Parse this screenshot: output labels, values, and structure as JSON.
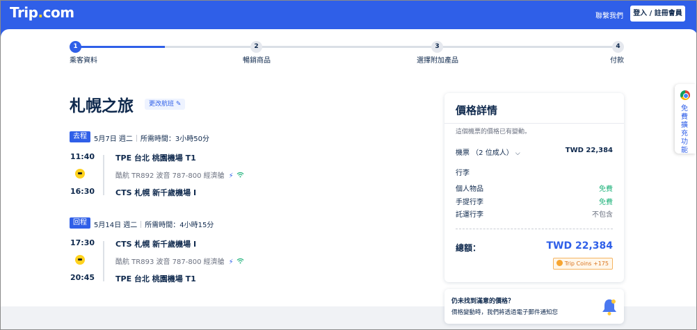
{
  "header": {
    "logo_main": "Trip",
    "logo_dot": ".",
    "logo_tail": "com",
    "contact_label": "聯繫我們",
    "login_label": "登入 / 註冊會員"
  },
  "stepper": {
    "steps": [
      {
        "num": "1",
        "label": "乘客資料"
      },
      {
        "num": "2",
        "label": "暢銷商品"
      },
      {
        "num": "3",
        "label": "選擇附加產品"
      },
      {
        "num": "4",
        "label": "付款"
      }
    ],
    "current_step": 1
  },
  "trip": {
    "title": "札幌之旅",
    "change_flight_label": "更改航班"
  },
  "outbound": {
    "tag": "去程",
    "date": "5月7日 週二",
    "duration": "所需時間：3小時50分",
    "depart_time": "11:40",
    "depart_airport": "TPE 台北 桃園機場 T1",
    "flight_info": "酷航  TR892  波音 787-800  經濟艙",
    "arrive_time": "16:30",
    "arrive_airport": "CTS 札幌 新千歲機場 I"
  },
  "inbound": {
    "tag": "回程",
    "date": "5月14日 週二",
    "duration": "所需時間：4小時15分",
    "depart_time": "17:30",
    "depart_airport": "CTS 札幌 新千歲機場 I",
    "flight_info": "酷航  TR893  波音 787-800  經濟艙",
    "arrive_time": "20:45",
    "arrive_airport": "TPE 台北 桃園機場 T1"
  },
  "price": {
    "title": "價格詳情",
    "note": "這個機票的價格已有變動。",
    "tickets_label": "機票 （2 位成人）",
    "tickets_amount": "TWD 22,384",
    "baggage_heading": "行李",
    "baggage": [
      {
        "label": "個人物品",
        "value": "免費",
        "status": "free"
      },
      {
        "label": "手提行李",
        "value": "免費",
        "status": "free"
      },
      {
        "label": "託運行李",
        "value": "不包含",
        "status": "none"
      }
    ],
    "total_label": "總額：",
    "total_amount": "TWD 22,384",
    "coins_label": "Trip Coins +175"
  },
  "alert": {
    "title": "仍未找到滿意的價格？",
    "subtitle": "價格變動時，我們將透過電子郵件通知您"
  },
  "extension": {
    "label": "免費擴充功能"
  },
  "colors": {
    "brand": "#2f5fe8",
    "free": "#24b47e",
    "text": "#0f294d"
  }
}
